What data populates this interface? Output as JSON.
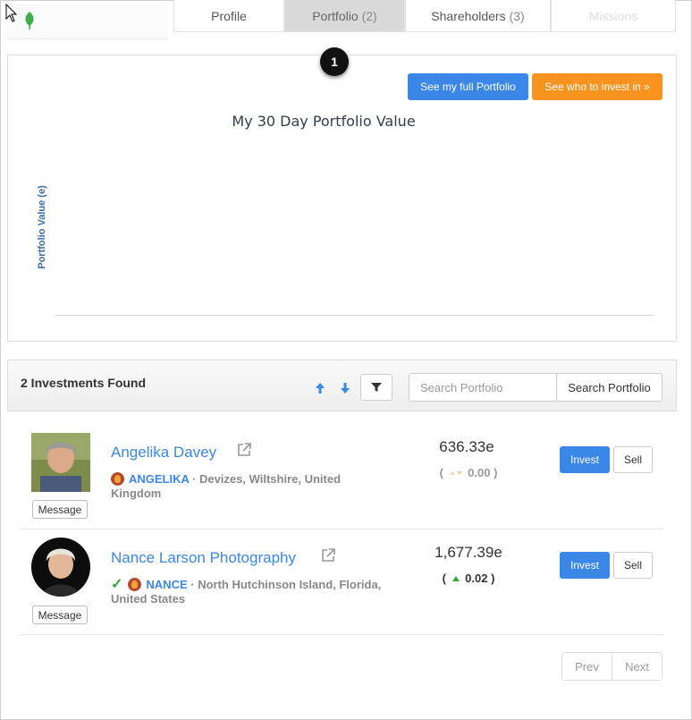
{
  "tabs": [
    {
      "label": "Profile",
      "count": ""
    },
    {
      "label": "Portfolio",
      "count": "(2)"
    },
    {
      "label": "Shareholders",
      "count": "(3)"
    },
    {
      "label": "Missions",
      "count": ""
    }
  ],
  "step_badge": "1",
  "actions": {
    "full_portfolio": "See my full Portfolio",
    "who_to_invest": "See who to invest in »"
  },
  "chart_data": {
    "type": "line",
    "title": "My 30 Day Portfolio Value",
    "xlabel": "",
    "ylabel": "Portfolio Value (e)",
    "series": [],
    "grid": false
  },
  "list": {
    "found_text": "2 Investments Found",
    "search_placeholder": "Search Portfolio",
    "search_button": "Search Portfolio"
  },
  "investments": [
    {
      "name": "Angelika Davey",
      "handle": "ANGELIKA",
      "location_line1": " · Devizes, Wiltshire, United",
      "location_line2": "Kingdom",
      "value": "636.33e",
      "change_open": "(",
      "change_value": "0.00",
      "change_close": ")",
      "message": "Message",
      "invest": "Invest",
      "sell": "Sell"
    },
    {
      "name": "Nance Larson Photography",
      "handle": "NANCE",
      "location_line1": " · North Hutchinson Island, Florida,",
      "location_line2": "United States",
      "value": "1,677.39e",
      "change_open": "(",
      "change_value": "0.02",
      "change_close": ")",
      "message": "Message",
      "invest": "Invest",
      "sell": "Sell"
    }
  ],
  "pager": {
    "prev": "Prev",
    "next": "Next"
  },
  "colors": {
    "primary": "#3b87e8",
    "accent_orange": "#f7931e",
    "positive": "#2eaa3e"
  }
}
